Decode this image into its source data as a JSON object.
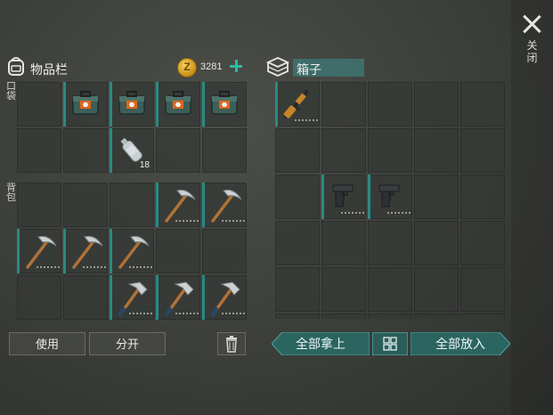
{
  "close": {
    "label": "关闭"
  },
  "inventory": {
    "title": "物品栏",
    "coins": "3281",
    "pocket_label": "口袋",
    "backpack_label": "背包",
    "pocket_slots": [
      {
        "item": "none"
      },
      {
        "item": "medkit-case"
      },
      {
        "item": "medkit-case"
      },
      {
        "item": "medkit-case"
      },
      {
        "item": "medkit-case"
      },
      {
        "item": "none"
      },
      {
        "item": "none"
      },
      {
        "item": "water-bottle",
        "qty": "18"
      },
      {
        "item": "none"
      },
      {
        "item": "none"
      }
    ],
    "backpack_slots": [
      {
        "item": "none"
      },
      {
        "item": "none"
      },
      {
        "item": "none"
      },
      {
        "item": "pickaxe"
      },
      {
        "item": "pickaxe"
      },
      {
        "item": "pickaxe"
      },
      {
        "item": "pickaxe"
      },
      {
        "item": "pickaxe"
      },
      {
        "item": "none"
      },
      {
        "item": "none"
      },
      {
        "item": "none"
      },
      {
        "item": "none"
      },
      {
        "item": "hatchet"
      },
      {
        "item": "hatchet"
      },
      {
        "item": "hatchet"
      }
    ],
    "use_label": "使用",
    "split_label": "分开"
  },
  "chest": {
    "title": "箱子",
    "slots": [
      {
        "item": "rifle"
      },
      {
        "item": "none"
      },
      {
        "item": "none"
      },
      {
        "item": "none"
      },
      {
        "item": "none"
      },
      {
        "item": "none"
      },
      {
        "item": "none"
      },
      {
        "item": "none"
      },
      {
        "item": "none"
      },
      {
        "item": "none"
      },
      {
        "item": "none"
      },
      {
        "item": "pistol"
      },
      {
        "item": "pistol"
      },
      {
        "item": "none"
      },
      {
        "item": "none"
      },
      {
        "item": "none"
      },
      {
        "item": "none"
      },
      {
        "item": "none"
      },
      {
        "item": "none"
      },
      {
        "item": "none"
      },
      {
        "item": "none"
      },
      {
        "item": "none"
      },
      {
        "item": "none"
      },
      {
        "item": "none"
      },
      {
        "item": "none"
      },
      {
        "item": "none"
      },
      {
        "item": "none"
      },
      {
        "item": "none"
      },
      {
        "item": "none"
      },
      {
        "item": "none"
      }
    ],
    "take_all_label": "全部拿上",
    "put_all_label": "全部放入"
  },
  "colors": {
    "accent": "#2a8a84",
    "slot": "#343834",
    "coin": "#e0b030"
  }
}
